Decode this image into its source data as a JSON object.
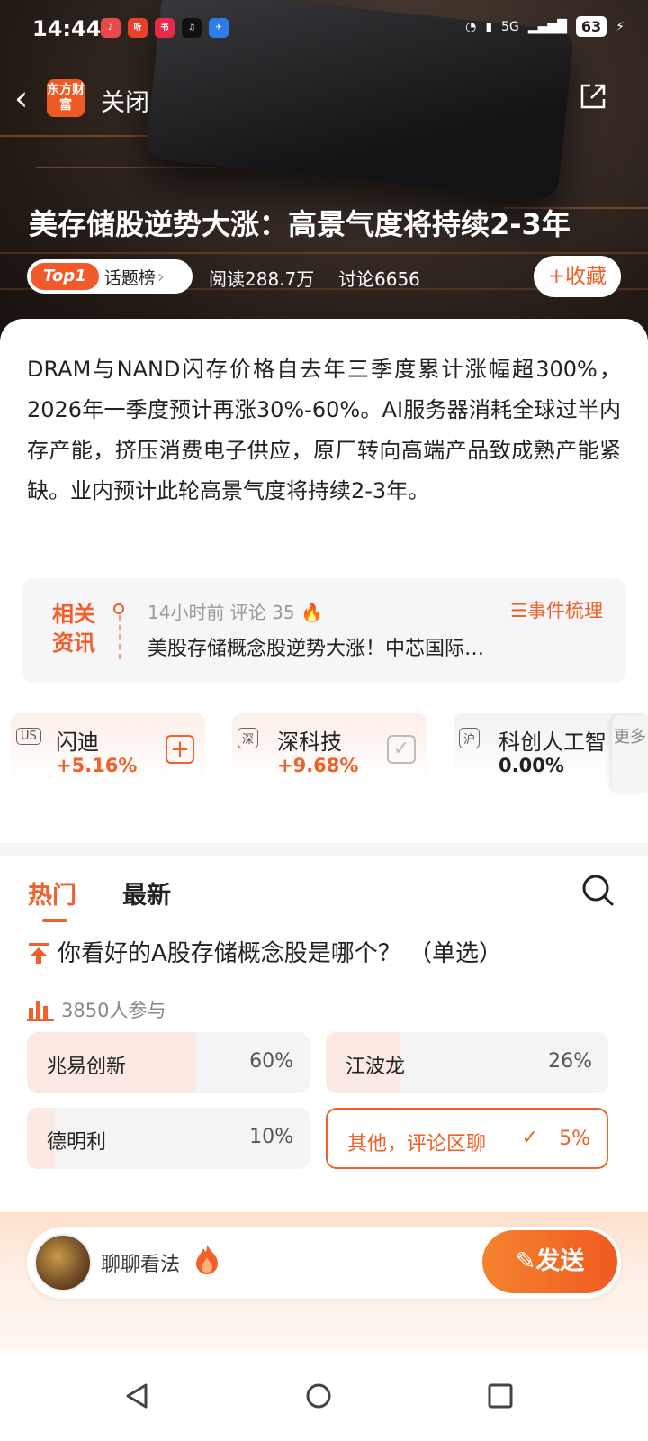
{
  "status_bar": {
    "time": "14:44",
    "network": "5G",
    "battery": "63"
  },
  "nav": {
    "close_label": "关闭",
    "logo_text": "东方财富"
  },
  "topic": {
    "title": "美存储股逆势大涨：高景气度将持续2-3年",
    "rank_badge": "Top1",
    "rank_label": "话题榜",
    "reads": "阅读288.7万",
    "discussions": "讨论6656",
    "favorite_label": "收藏",
    "description": "DRAM与NAND闪存价格自去年三季度累计涨幅超300%，2026年一季度预计再涨30%-60%。AI服务器消耗全球过半内存产能，挤压消费电子供应，原厂转向高端产品致成熟产能紧缺。业内预计此轮高景气度将持续2-3年。"
  },
  "news": {
    "label": "相关资讯",
    "meta": "14小时前 评论 35",
    "event_link": "事件梳理",
    "headline": "美股存储概念股逆势大涨！中芯国际…"
  },
  "stocks": [
    {
      "market": "US",
      "name": "闪迪",
      "change": "+5.16%",
      "action": "add"
    },
    {
      "market": "深",
      "name": "深科技",
      "change": "+9.68%",
      "action": "added"
    },
    {
      "market": "沪",
      "name": "科创人工智",
      "change": "0.00%",
      "action": "none"
    }
  ],
  "more_label": "更多",
  "tabs": [
    {
      "label": "热门",
      "active": true
    },
    {
      "label": "最新",
      "active": false
    }
  ],
  "poll": {
    "question": "你看好的A股存储概念股是哪个？ （单选）",
    "participants": "3850人参与",
    "options": [
      {
        "name": "兆易创新",
        "percent": "60%",
        "ratio": 0.6,
        "selected": false
      },
      {
        "name": "江波龙",
        "percent": "26%",
        "ratio": 0.26,
        "selected": false
      },
      {
        "name": "德明利",
        "percent": "10%",
        "ratio": 0.1,
        "selected": false
      },
      {
        "name": "其他，评论区聊",
        "percent": "5%",
        "ratio": 0.05,
        "selected": true
      }
    ]
  },
  "composer": {
    "placeholder": "聊聊看法",
    "send_label": "发送"
  },
  "colors": {
    "accent": "#f0602a",
    "up": "#f0602a"
  }
}
